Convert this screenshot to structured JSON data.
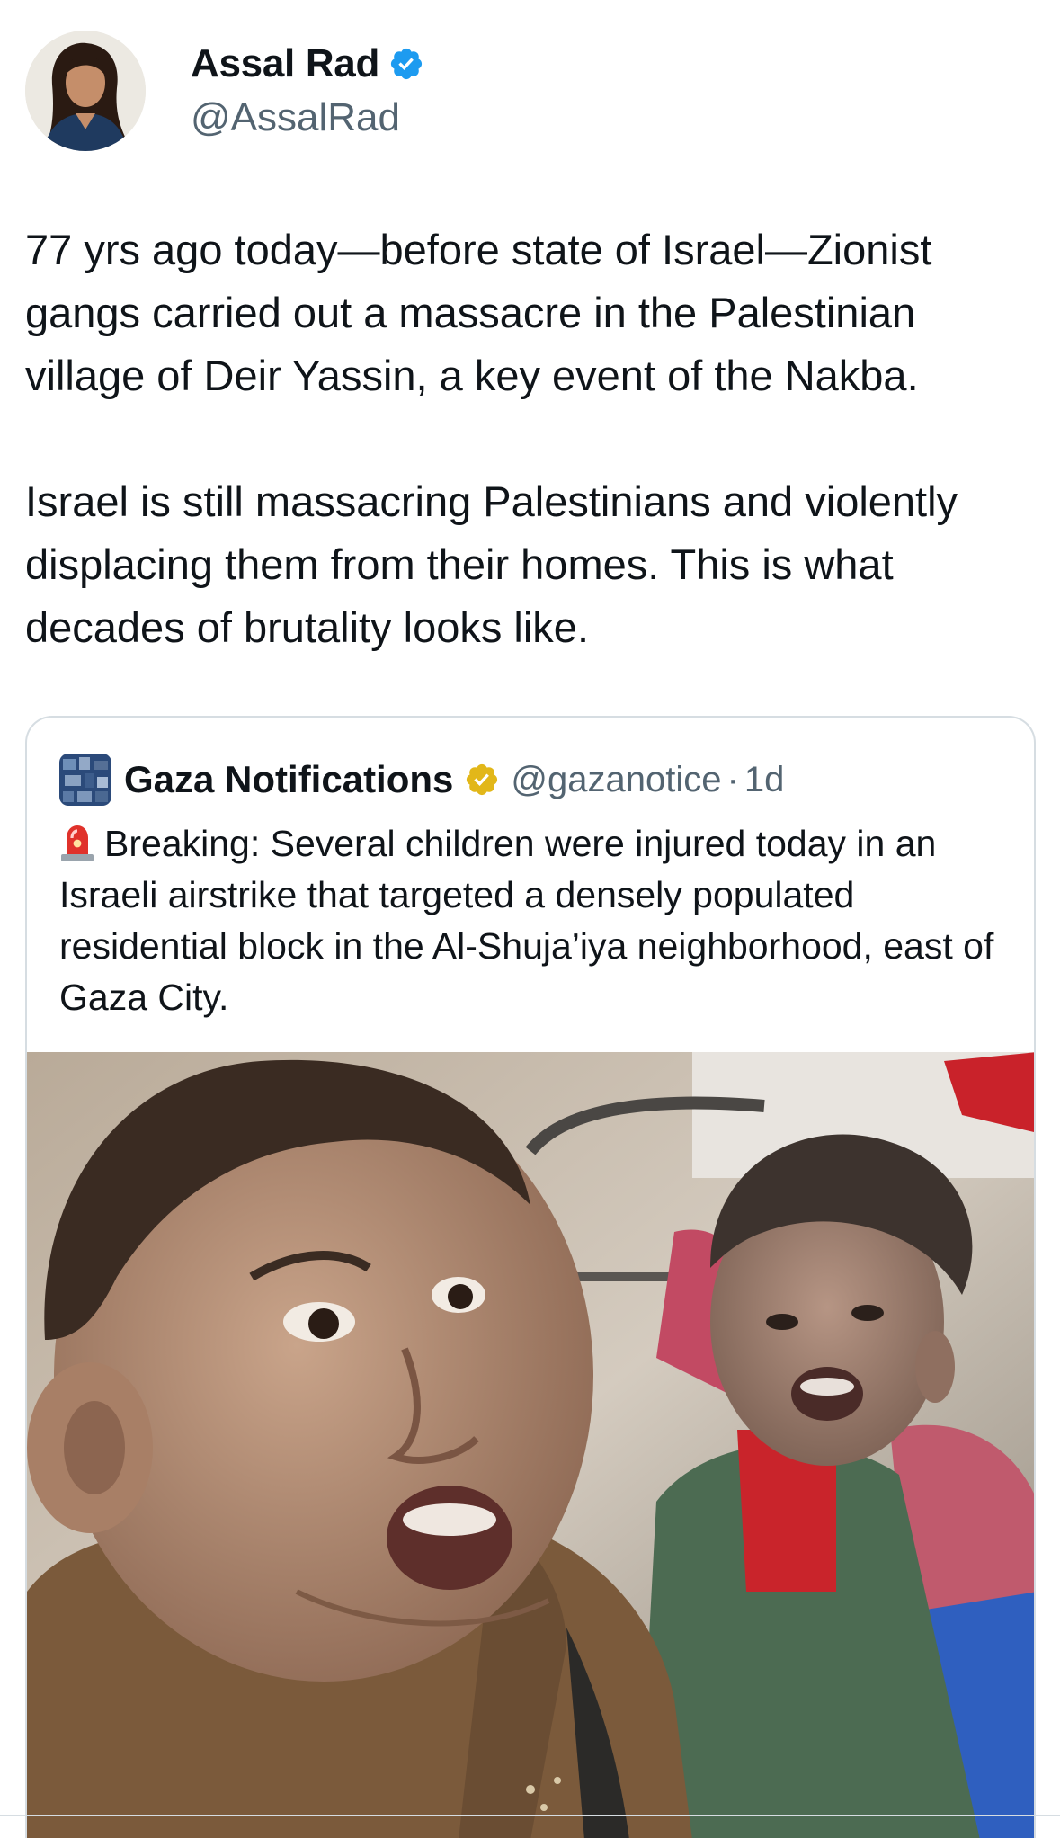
{
  "author": {
    "display_name": "Assal Rad",
    "handle": "@AssalRad",
    "verified_icon": "verified-badge-blue",
    "verified_color": "#1d9bf0"
  },
  "tweet": {
    "paragraph_1": "77 yrs ago today—before state of Israel—Zionist gangs carried out a massacre in the Palestinian village of Deir Yassin, a key event of the Nakba.",
    "paragraph_2": "Israel is still massacring Palestinians and violently displacing them from their homes. This is what decades of brutality looks like."
  },
  "quoted_tweet": {
    "display_name": "Gaza Notifications",
    "verified_icon": "verified-badge-gold",
    "verified_color": "#e2b719",
    "handle": "@gazanotice",
    "separator": "·",
    "time": "1d",
    "emoji_icon": "police-light-icon",
    "text": "Breaking: Several children were injured today in an Israeli airstrike that targeted a densely populated residential block in the Al-Shuja’iya neighborhood, east of Gaza City."
  },
  "colors": {
    "text_primary": "#0f1419",
    "text_secondary": "#536471",
    "border": "#d6dde2"
  }
}
